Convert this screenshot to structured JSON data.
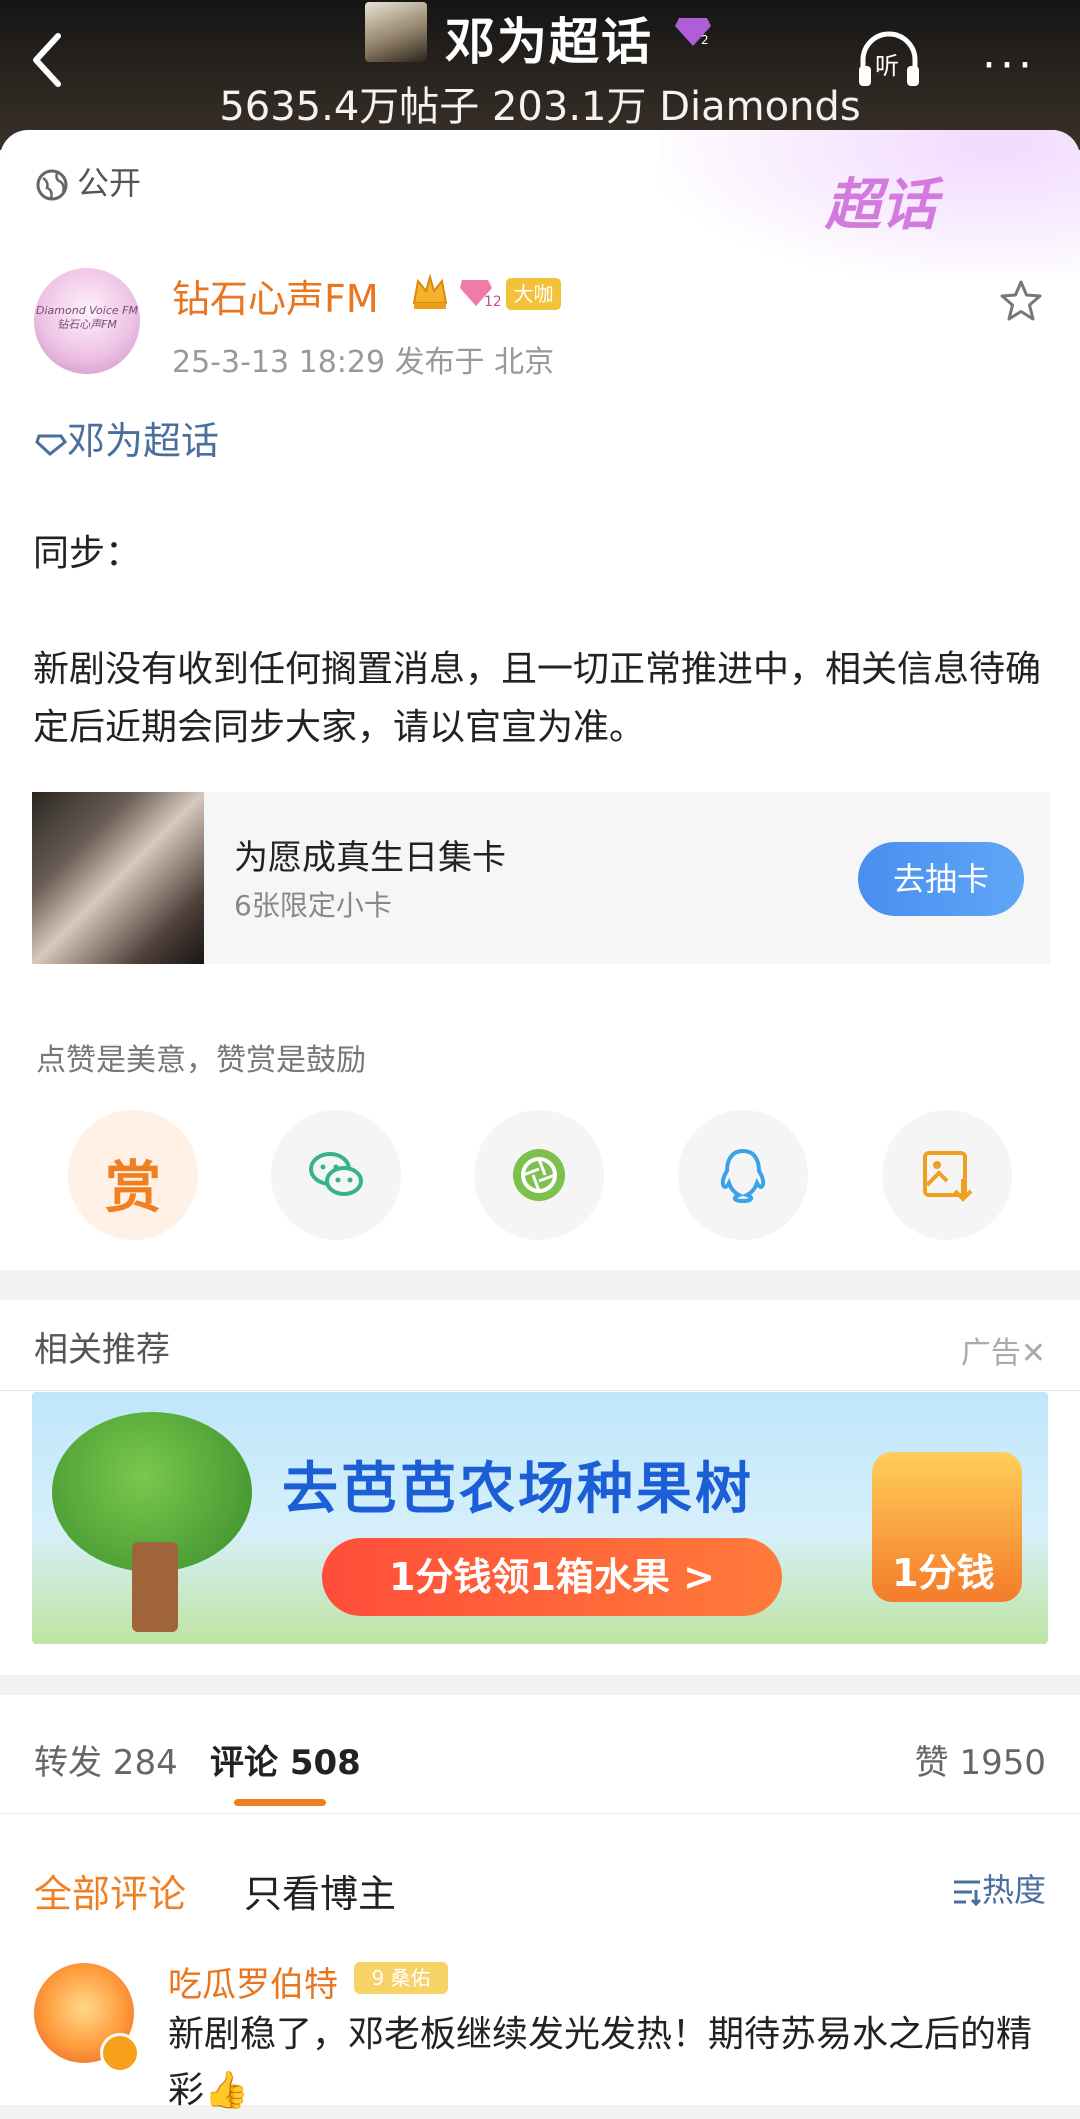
{
  "header": {
    "title": "邓为超话",
    "stats": "5635.4万帖子 203.1万 Diamonds",
    "gem_badge": "2",
    "listen_label": "听",
    "more_label": "···"
  },
  "post": {
    "visibility": "公开",
    "card_logo": "超话",
    "author": "钻石心声FM",
    "author_level": "12",
    "author_badge": "大咖",
    "avatar_text": "Diamond Voice FM 钻石心声FM",
    "meta": "25-3-13 18:29  发布于 北京",
    "topic_link": "邓为超话",
    "body_line1": "同步：",
    "body_line2": "新剧没有收到任何搁置消息，且一切正常推进中，相关信息待确定后近期会同步大家，请以官宣为准。",
    "collect": {
      "title": "为愿成真生日集卡",
      "subtitle": "6张限定小卡",
      "button": "去抽卡"
    },
    "praise_hint": "点赞是美意，赞赏是鼓励",
    "reward_label": "赏"
  },
  "recommend": {
    "title": "相关推荐",
    "ad_label": "广告✕",
    "ad": {
      "headline": "去芭芭农场种果树",
      "pill": "1分钱领1箱水果 >",
      "price": "1分钱"
    }
  },
  "stats": {
    "repost": "转发 284",
    "comment": "评论 508",
    "like": "赞 1950"
  },
  "comments": {
    "filter_all": "全部评论",
    "filter_host": "只看博主",
    "sort": "热度",
    "first": {
      "user": "吃瓜罗伯特",
      "badge": "9 桑佑",
      "text": "新剧稳了，邓老板继续发光发热！期待苏易水之后的精彩👍"
    }
  },
  "colors": {
    "accent": "#f07f22",
    "link": "#4a6f9f",
    "button_blue": "#4a8ef0"
  }
}
